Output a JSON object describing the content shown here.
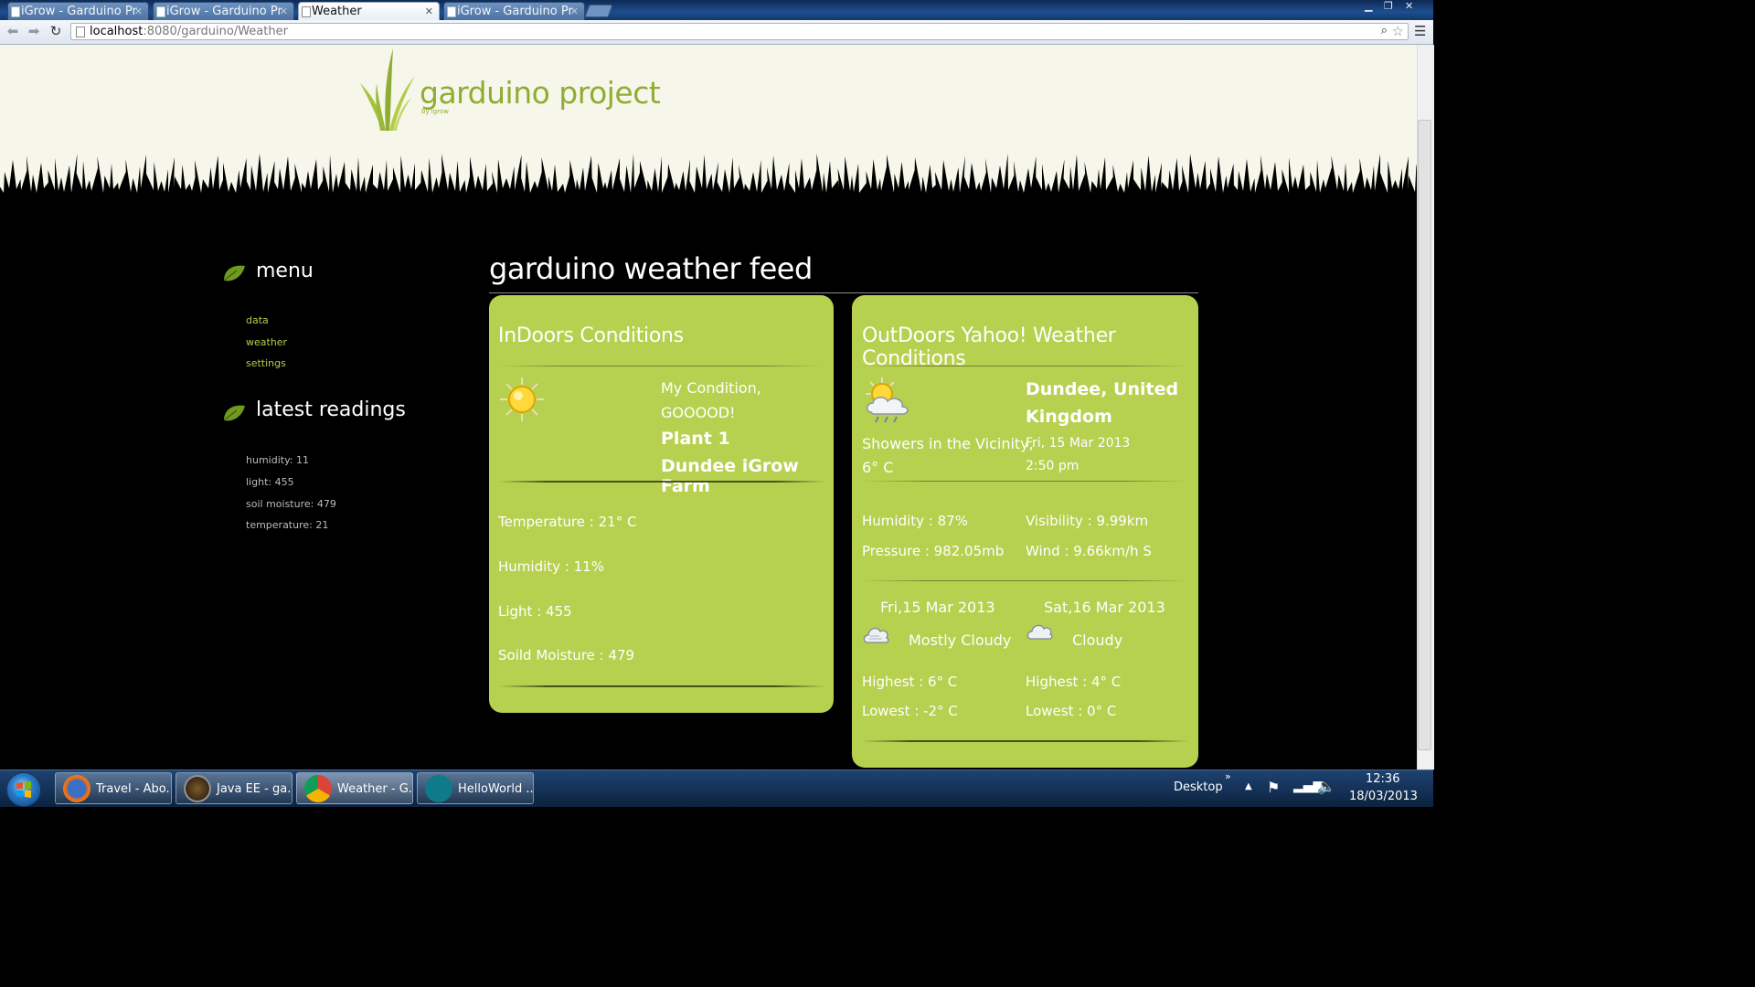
{
  "browser": {
    "tabs": [
      {
        "title": "iGrow - Garduino Pr"
      },
      {
        "title": "iGrow - Garduino Pr"
      },
      {
        "title": "Weather"
      },
      {
        "title": "iGrow - Garduino Pr"
      }
    ],
    "url_host": "localhost",
    "url_rest": ":8080/garduino/Weather"
  },
  "site": {
    "logo_text": "garduino project",
    "logo_sub": "by igrow"
  },
  "sidebar": {
    "menu_heading": "menu",
    "menu_items": [
      "data",
      "weather",
      "settings"
    ],
    "readings_heading": "latest readings",
    "readings": [
      "humidity: 11",
      "light: 455",
      "soil moisture: 479",
      "temperature: 21"
    ]
  },
  "feed": {
    "title": "garduino weather feed",
    "indoor": {
      "title": "InDoors Conditions",
      "condition_line1": "My Condition,",
      "condition_line2": "GOOOOD!",
      "plant": "Plant 1",
      "farm": "Dundee iGrow Farm",
      "temperature": "Temperature : 21° C",
      "humidity": "Humidity : 11%",
      "light": "Light : 455",
      "moisture": "Soild Moisture : 479"
    },
    "outdoor": {
      "title": "OutDoors Yahoo! Weather Conditions",
      "location_line1": "Dundee, United",
      "location_line2": "Kingdom",
      "condition": "Showers in the Vicinity,",
      "temp": "6° C",
      "date": "Fri, 15 Mar 2013",
      "time": "2:50 pm",
      "humidity": "Humidity : 87%",
      "visibility": "Visibility : 9.99km",
      "pressure": "Pressure : 982.05mb",
      "wind": "Wind : 9.66km/h S",
      "forecast": [
        {
          "day": "Fri,15 Mar 2013",
          "text": "Mostly Cloudy",
          "high": "Highest : 6° C",
          "low": "Lowest : -2° C"
        },
        {
          "day": "Sat,16 Mar 2013",
          "text": "Cloudy",
          "high": "Highest : 4° C",
          "low": "Lowest : 0° C"
        }
      ]
    }
  },
  "taskbar": {
    "buttons": [
      {
        "label": "Travel - Abo..."
      },
      {
        "label": "Java EE - ga..."
      },
      {
        "label": "Weather - G..."
      },
      {
        "label": "HelloWorld ..."
      }
    ],
    "desktop_label": "Desktop",
    "time": "12:36",
    "date": "18/03/2013"
  },
  "icons": {
    "indoor_weather": "sun-icon",
    "outdoor_weather": "sun-cloud-rain-icon",
    "forecast_1": "cloud-icon",
    "forecast_2": "cloud-icon",
    "menu_bullet": "leaf-icon"
  },
  "colors": {
    "panel_green": "#b6d050",
    "link_green": "#b2d14b",
    "logo_green": "#8fac33",
    "header_bg": "#f6f7ea"
  }
}
